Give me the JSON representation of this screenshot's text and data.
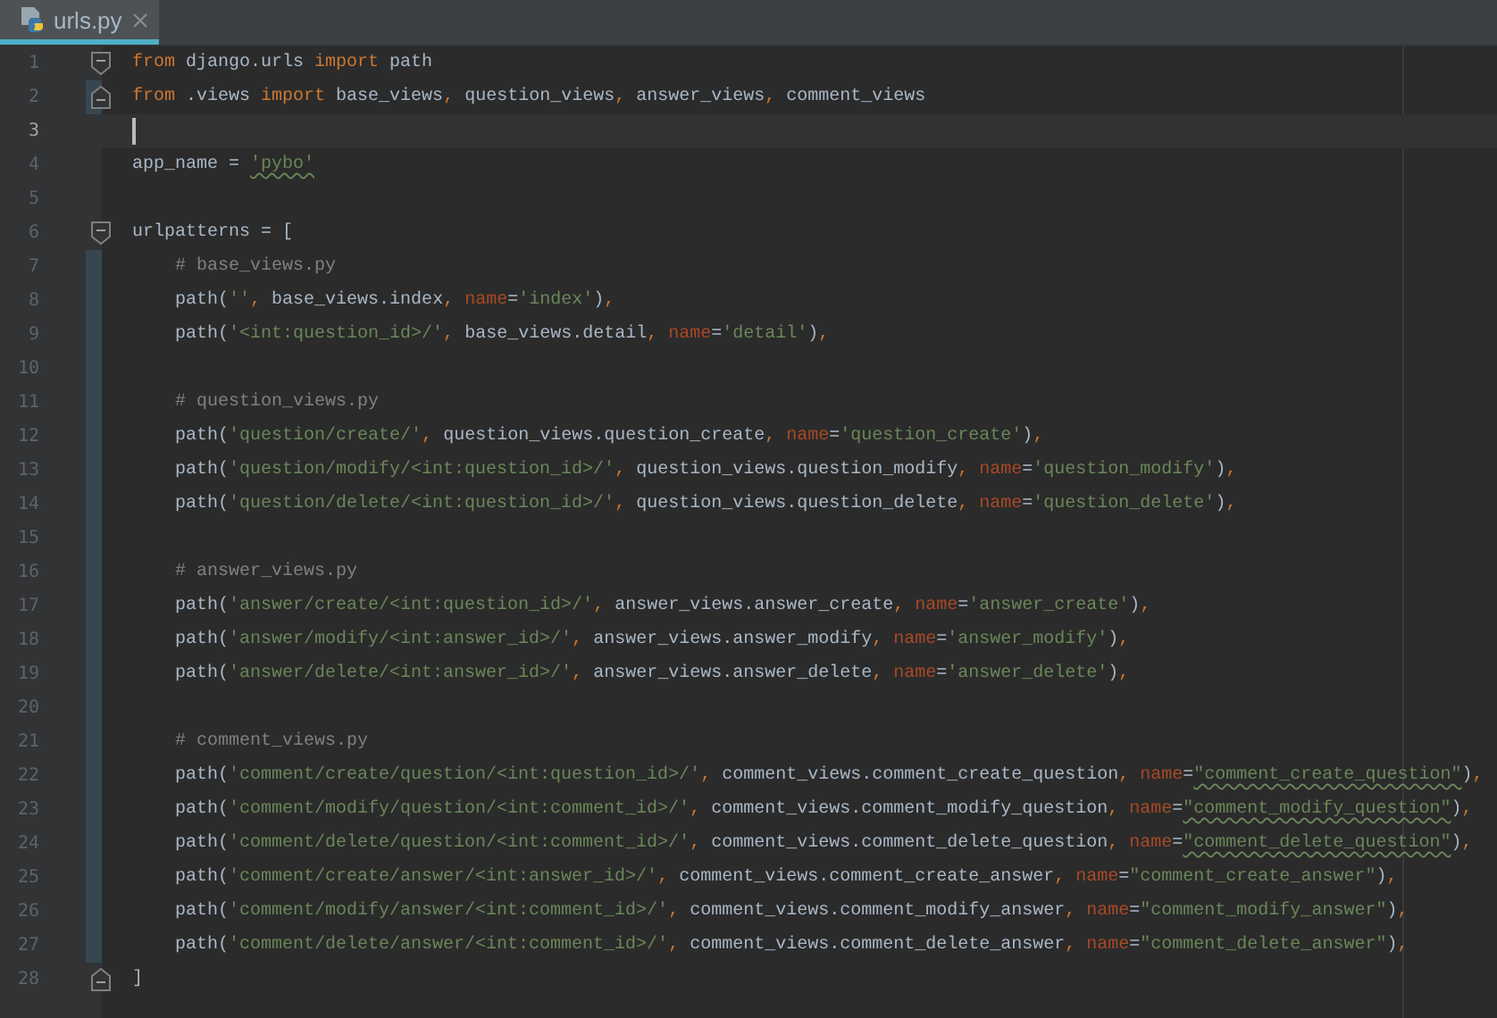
{
  "tab": {
    "title": "urls.py",
    "selected": true
  },
  "lines": [
    {
      "number": "1",
      "current": false,
      "changed": false,
      "fold_start": true,
      "tokens": [
        {
          "kind": "kw",
          "text": "from"
        },
        {
          "kind": "text",
          "text": " django.urls "
        },
        {
          "kind": "kw",
          "text": "import"
        },
        {
          "kind": "text",
          "text": " path"
        }
      ]
    },
    {
      "number": "2",
      "current": false,
      "changed": true,
      "fold_end": true,
      "tokens": [
        {
          "kind": "kw",
          "text": "from"
        },
        {
          "kind": "text",
          "text": " .views "
        },
        {
          "kind": "kw",
          "text": "import"
        },
        {
          "kind": "text",
          "text": " base_views"
        },
        {
          "kind": "punct",
          "text": ","
        },
        {
          "kind": "text",
          "text": " question_views"
        },
        {
          "kind": "punct",
          "text": ","
        },
        {
          "kind": "text",
          "text": " answer_views"
        },
        {
          "kind": "punct",
          "text": ","
        },
        {
          "kind": "text",
          "text": " comment_views"
        }
      ]
    },
    {
      "number": "3",
      "current": true,
      "changed": false
    },
    {
      "number": "4",
      "current": false,
      "changed": false,
      "tokens": [
        {
          "kind": "text",
          "text": "app_name = "
        },
        {
          "kind": "str-warn",
          "text": "'pybo'"
        }
      ]
    },
    {
      "number": "5",
      "current": false,
      "changed": false
    },
    {
      "number": "6",
      "current": false,
      "changed": false,
      "fold_start": true,
      "tokens": [
        {
          "kind": "text",
          "text": "urlpatterns = ["
        }
      ]
    },
    {
      "number": "7",
      "current": false,
      "changed": true,
      "tokens": [
        {
          "kind": "comment",
          "text": "    # base_views.py"
        }
      ]
    },
    {
      "number": "8",
      "current": false,
      "changed": true,
      "tokens": [
        {
          "kind": "text",
          "text": "    path("
        },
        {
          "kind": "str",
          "text": "''"
        },
        {
          "kind": "punct",
          "text": ","
        },
        {
          "kind": "text",
          "text": " base_views.index"
        },
        {
          "kind": "punct",
          "text": ","
        },
        {
          "kind": "arg",
          "text": " name"
        },
        {
          "kind": "text",
          "text": "="
        },
        {
          "kind": "str",
          "text": "'index'"
        },
        {
          "kind": "text",
          "text": ")"
        },
        {
          "kind": "punct",
          "text": ","
        }
      ]
    },
    {
      "number": "9",
      "current": false,
      "changed": true,
      "tokens": [
        {
          "kind": "text",
          "text": "    path("
        },
        {
          "kind": "str",
          "text": "'<int:question_id>/'"
        },
        {
          "kind": "punct",
          "text": ","
        },
        {
          "kind": "text",
          "text": " base_views.detail"
        },
        {
          "kind": "punct",
          "text": ","
        },
        {
          "kind": "arg",
          "text": " name"
        },
        {
          "kind": "text",
          "text": "="
        },
        {
          "kind": "str",
          "text": "'detail'"
        },
        {
          "kind": "text",
          "text": ")"
        },
        {
          "kind": "punct",
          "text": ","
        }
      ]
    },
    {
      "number": "10",
      "current": false,
      "changed": true
    },
    {
      "number": "11",
      "current": false,
      "changed": true,
      "tokens": [
        {
          "kind": "comment",
          "text": "    # question_views.py"
        }
      ]
    },
    {
      "number": "12",
      "current": false,
      "changed": true,
      "tokens": [
        {
          "kind": "text",
          "text": "    path("
        },
        {
          "kind": "str",
          "text": "'question/create/'"
        },
        {
          "kind": "punct",
          "text": ","
        },
        {
          "kind": "text",
          "text": " question_views.question_create"
        },
        {
          "kind": "punct",
          "text": ","
        },
        {
          "kind": "arg",
          "text": " name"
        },
        {
          "kind": "text",
          "text": "="
        },
        {
          "kind": "str",
          "text": "'question_create'"
        },
        {
          "kind": "text",
          "text": ")"
        },
        {
          "kind": "punct",
          "text": ","
        }
      ]
    },
    {
      "number": "13",
      "current": false,
      "changed": true,
      "tokens": [
        {
          "kind": "text",
          "text": "    path("
        },
        {
          "kind": "str",
          "text": "'question/modify/<int:question_id>/'"
        },
        {
          "kind": "punct",
          "text": ","
        },
        {
          "kind": "text",
          "text": " question_views.question_modify"
        },
        {
          "kind": "punct",
          "text": ","
        },
        {
          "kind": "arg",
          "text": " name"
        },
        {
          "kind": "text",
          "text": "="
        },
        {
          "kind": "str",
          "text": "'question_modify'"
        },
        {
          "kind": "text",
          "text": ")"
        },
        {
          "kind": "punct",
          "text": ","
        }
      ]
    },
    {
      "number": "14",
      "current": false,
      "changed": true,
      "tokens": [
        {
          "kind": "text",
          "text": "    path("
        },
        {
          "kind": "str",
          "text": "'question/delete/<int:question_id>/'"
        },
        {
          "kind": "punct",
          "text": ","
        },
        {
          "kind": "text",
          "text": " question_views.question_delete"
        },
        {
          "kind": "punct",
          "text": ","
        },
        {
          "kind": "arg",
          "text": " name"
        },
        {
          "kind": "text",
          "text": "="
        },
        {
          "kind": "str",
          "text": "'question_delete'"
        },
        {
          "kind": "text",
          "text": ")"
        },
        {
          "kind": "punct",
          "text": ","
        }
      ]
    },
    {
      "number": "15",
      "current": false,
      "changed": true
    },
    {
      "number": "16",
      "current": false,
      "changed": true,
      "tokens": [
        {
          "kind": "comment",
          "text": "    # answer_views.py"
        }
      ]
    },
    {
      "number": "17",
      "current": false,
      "changed": true,
      "tokens": [
        {
          "kind": "text",
          "text": "    path("
        },
        {
          "kind": "str",
          "text": "'answer/create/<int:question_id>/'"
        },
        {
          "kind": "punct",
          "text": ","
        },
        {
          "kind": "text",
          "text": " answer_views.answer_create"
        },
        {
          "kind": "punct",
          "text": ","
        },
        {
          "kind": "arg",
          "text": " name"
        },
        {
          "kind": "text",
          "text": "="
        },
        {
          "kind": "str",
          "text": "'answer_create'"
        },
        {
          "kind": "text",
          "text": ")"
        },
        {
          "kind": "punct",
          "text": ","
        }
      ]
    },
    {
      "number": "18",
      "current": false,
      "changed": true,
      "tokens": [
        {
          "kind": "text",
          "text": "    path("
        },
        {
          "kind": "str",
          "text": "'answer/modify/<int:answer_id>/'"
        },
        {
          "kind": "punct",
          "text": ","
        },
        {
          "kind": "text",
          "text": " answer_views.answer_modify"
        },
        {
          "kind": "punct",
          "text": ","
        },
        {
          "kind": "arg",
          "text": " name"
        },
        {
          "kind": "text",
          "text": "="
        },
        {
          "kind": "str",
          "text": "'answer_modify'"
        },
        {
          "kind": "text",
          "text": ")"
        },
        {
          "kind": "punct",
          "text": ","
        }
      ]
    },
    {
      "number": "19",
      "current": false,
      "changed": true,
      "tokens": [
        {
          "kind": "text",
          "text": "    path("
        },
        {
          "kind": "str",
          "text": "'answer/delete/<int:answer_id>/'"
        },
        {
          "kind": "punct",
          "text": ","
        },
        {
          "kind": "text",
          "text": " answer_views.answer_delete"
        },
        {
          "kind": "punct",
          "text": ","
        },
        {
          "kind": "arg",
          "text": " name"
        },
        {
          "kind": "text",
          "text": "="
        },
        {
          "kind": "str",
          "text": "'answer_delete'"
        },
        {
          "kind": "text",
          "text": ")"
        },
        {
          "kind": "punct",
          "text": ","
        }
      ]
    },
    {
      "number": "20",
      "current": false,
      "changed": true
    },
    {
      "number": "21",
      "current": false,
      "changed": true,
      "tokens": [
        {
          "kind": "comment",
          "text": "    # comment_views.py"
        }
      ]
    },
    {
      "number": "22",
      "current": false,
      "changed": true,
      "tokens": [
        {
          "kind": "text",
          "text": "    path("
        },
        {
          "kind": "str",
          "text": "'comment/create/question/<int:question_id>/'"
        },
        {
          "kind": "punct",
          "text": ","
        },
        {
          "kind": "text",
          "text": " comment_views.comment_create_question"
        },
        {
          "kind": "punct",
          "text": ","
        },
        {
          "kind": "arg",
          "text": " name"
        },
        {
          "kind": "text",
          "text": "="
        },
        {
          "kind": "str-warn",
          "text": "\"comment_create_question\""
        },
        {
          "kind": "text",
          "text": ")"
        },
        {
          "kind": "punct",
          "text": ","
        }
      ]
    },
    {
      "number": "23",
      "current": false,
      "changed": true,
      "tokens": [
        {
          "kind": "text",
          "text": "    path("
        },
        {
          "kind": "str",
          "text": "'comment/modify/question/<int:comment_id>/'"
        },
        {
          "kind": "punct",
          "text": ","
        },
        {
          "kind": "text",
          "text": " comment_views.comment_modify_question"
        },
        {
          "kind": "punct",
          "text": ","
        },
        {
          "kind": "arg",
          "text": " name"
        },
        {
          "kind": "text",
          "text": "="
        },
        {
          "kind": "str-warn",
          "text": "\"comment_modify_question\""
        },
        {
          "kind": "text",
          "text": ")"
        },
        {
          "kind": "punct",
          "text": ","
        }
      ]
    },
    {
      "number": "24",
      "current": false,
      "changed": true,
      "tokens": [
        {
          "kind": "text",
          "text": "    path("
        },
        {
          "kind": "str",
          "text": "'comment/delete/question/<int:comment_id>/'"
        },
        {
          "kind": "punct",
          "text": ","
        },
        {
          "kind": "text",
          "text": " comment_views.comment_delete_question"
        },
        {
          "kind": "punct",
          "text": ","
        },
        {
          "kind": "arg",
          "text": " name"
        },
        {
          "kind": "text",
          "text": "="
        },
        {
          "kind": "str-warn",
          "text": "\"comment_delete_question\""
        },
        {
          "kind": "text",
          "text": ")"
        },
        {
          "kind": "punct",
          "text": ","
        }
      ]
    },
    {
      "number": "25",
      "current": false,
      "changed": true,
      "tokens": [
        {
          "kind": "text",
          "text": "    path("
        },
        {
          "kind": "str",
          "text": "'comment/create/answer/<int:answer_id>/'"
        },
        {
          "kind": "punct",
          "text": ","
        },
        {
          "kind": "text",
          "text": " comment_views.comment_create_answer"
        },
        {
          "kind": "punct",
          "text": ","
        },
        {
          "kind": "arg",
          "text": " name"
        },
        {
          "kind": "text",
          "text": "="
        },
        {
          "kind": "str",
          "text": "\"comment_create_answer\""
        },
        {
          "kind": "text",
          "text": ")"
        },
        {
          "kind": "punct",
          "text": ","
        }
      ]
    },
    {
      "number": "26",
      "current": false,
      "changed": true,
      "tokens": [
        {
          "kind": "text",
          "text": "    path("
        },
        {
          "kind": "str",
          "text": "'comment/modify/answer/<int:comment_id>/'"
        },
        {
          "kind": "punct",
          "text": ","
        },
        {
          "kind": "text",
          "text": " comment_views.comment_modify_answer"
        },
        {
          "kind": "punct",
          "text": ","
        },
        {
          "kind": "arg",
          "text": " name"
        },
        {
          "kind": "text",
          "text": "="
        },
        {
          "kind": "str",
          "text": "\"comment_modify_answer\""
        },
        {
          "kind": "text",
          "text": ")"
        },
        {
          "kind": "punct",
          "text": ","
        }
      ]
    },
    {
      "number": "27",
      "current": false,
      "changed": true,
      "tokens": [
        {
          "kind": "text",
          "text": "    path("
        },
        {
          "kind": "str",
          "text": "'comment/delete/answer/<int:comment_id>/'"
        },
        {
          "kind": "punct",
          "text": ","
        },
        {
          "kind": "text",
          "text": " comment_views.comment_delete_answer"
        },
        {
          "kind": "punct",
          "text": ","
        },
        {
          "kind": "arg",
          "text": " name"
        },
        {
          "kind": "text",
          "text": "="
        },
        {
          "kind": "str",
          "text": "\"comment_delete_answer\""
        },
        {
          "kind": "text",
          "text": ")"
        },
        {
          "kind": "punct",
          "text": ","
        }
      ]
    },
    {
      "number": "28",
      "current": false,
      "changed": false,
      "fold_end": true,
      "tokens": [
        {
          "kind": "text",
          "text": "]"
        }
      ]
    }
  ]
}
